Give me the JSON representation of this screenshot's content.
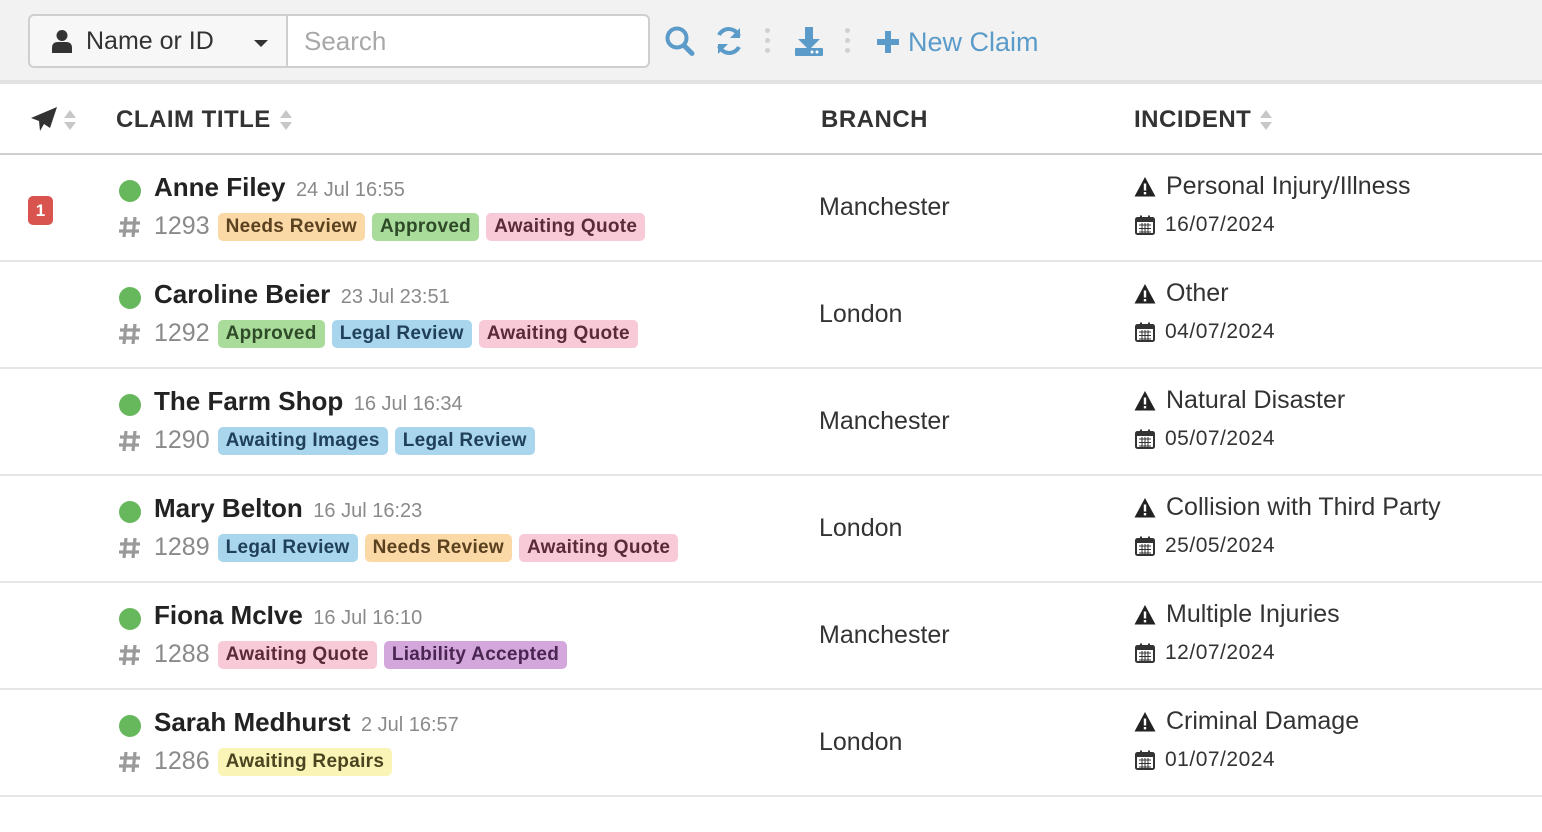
{
  "toolbar": {
    "filter_label": "Name or ID",
    "search_placeholder": "Search",
    "new_claim_label": "New Claim",
    "accent_color": "#5b9bc9"
  },
  "headers": {
    "claim_title": "CLAIM TITLE",
    "branch": "BRANCH",
    "incident": "INCIDENT"
  },
  "tag_colors": {
    "Needs Review": {
      "bg": "#fbd9a6",
      "fg": "#5a4120"
    },
    "Approved": {
      "bg": "#a9dc9a",
      "fg": "#2e4a28"
    },
    "Awaiting Quote": {
      "bg": "#f8c9d6",
      "fg": "#5a2a38"
    },
    "Legal Review": {
      "bg": "#a9d6ec",
      "fg": "#20405a"
    },
    "Awaiting Images": {
      "bg": "#a9d6ec",
      "fg": "#20405a"
    },
    "Liability Accepted": {
      "bg": "#d3a6dc",
      "fg": "#4a2552"
    },
    "Awaiting Repairs": {
      "bg": "#fbf4b7",
      "fg": "#4a4520"
    }
  },
  "claims": [
    {
      "name": "Anne Filey",
      "time": "24 Jul 16:55",
      "id": "1293",
      "badge": "1",
      "tags": [
        "Needs Review",
        "Approved",
        "Awaiting Quote"
      ],
      "branch": "Manchester",
      "incident": "Personal Injury/Illness",
      "date": "16/07/2024"
    },
    {
      "name": "Caroline Beier",
      "time": "23 Jul 23:51",
      "id": "1292",
      "badge": "",
      "tags": [
        "Approved",
        "Legal Review",
        "Awaiting Quote"
      ],
      "branch": "London",
      "incident": "Other",
      "date": "04/07/2024"
    },
    {
      "name": "The Farm Shop",
      "time": "16 Jul 16:34",
      "id": "1290",
      "badge": "",
      "tags": [
        "Awaiting Images",
        "Legal Review"
      ],
      "branch": "Manchester",
      "incident": "Natural Disaster",
      "date": "05/07/2024"
    },
    {
      "name": "Mary Belton",
      "time": "16 Jul 16:23",
      "id": "1289",
      "badge": "",
      "tags": [
        "Legal Review",
        "Needs Review",
        "Awaiting Quote"
      ],
      "branch": "London",
      "incident": "Collision with Third Party",
      "date": "25/05/2024"
    },
    {
      "name": "Fiona McIve",
      "time": "16 Jul 16:10",
      "id": "1288",
      "badge": "",
      "tags": [
        "Awaiting Quote",
        "Liability Accepted"
      ],
      "branch": "Manchester",
      "incident": "Multiple Injuries",
      "date": "12/07/2024"
    },
    {
      "name": "Sarah Medhurst",
      "time": "2 Jul 16:57",
      "id": "1286",
      "badge": "",
      "tags": [
        "Awaiting Repairs"
      ],
      "branch": "London",
      "incident": "Criminal Damage",
      "date": "01/07/2024"
    }
  ]
}
